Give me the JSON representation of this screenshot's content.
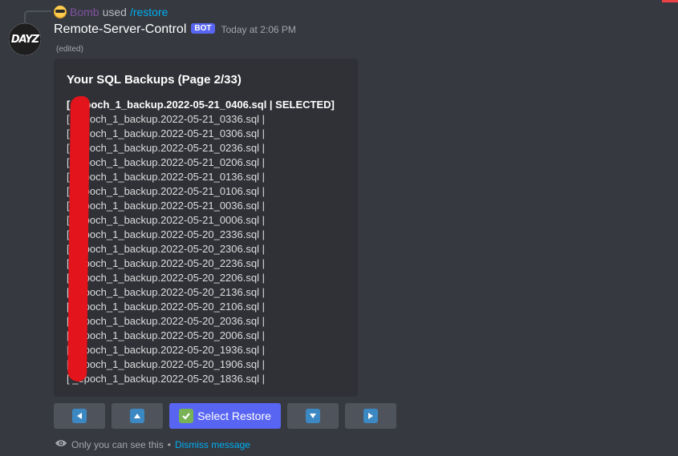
{
  "reply": {
    "username": "Bomb",
    "used_text": "used",
    "command": "/restore"
  },
  "message": {
    "author": "Remote-Server-Control",
    "bot_tag": "BOT",
    "timestamp": "Today at 2:06 PM",
    "edited": "(edited)",
    "avatar_text": "DAYZ"
  },
  "embed": {
    "title": "Your SQL Backups (Page 2/33)",
    "backups": [
      "[ _epoch_1_backup.2022-05-21_0406.sql | SELECTED]",
      "[ _epoch_1_backup.2022-05-21_0336.sql |",
      "[ _epoch_1_backup.2022-05-21_0306.sql |",
      "[ _epoch_1_backup.2022-05-21_0236.sql |",
      "[ _epoch_1_backup.2022-05-21_0206.sql |",
      "[ _epoch_1_backup.2022-05-21_0136.sql |",
      "[ _epoch_1_backup.2022-05-21_0106.sql |",
      "[ _epoch_1_backup.2022-05-21_0036.sql |",
      "[ _epoch_1_backup.2022-05-21_0006.sql |",
      "[ _epoch_1_backup.2022-05-20_2336.sql |",
      "[ _epoch_1_backup.2022-05-20_2306.sql |",
      "[ _epoch_1_backup.2022-05-20_2236.sql |",
      "[ _epoch_1_backup.2022-05-20_2206.sql |",
      "[ _epoch_1_backup.2022-05-20_2136.sql |",
      "[ _epoch_1_backup.2022-05-20_2106.sql |",
      "[ _epoch_1_backup.2022-05-20_2036.sql |",
      "[ _epoch_1_backup.2022-05-20_2006.sql |",
      "[ _epoch_1_backup.2022-05-20_1936.sql |",
      "[ _epoch_1_backup.2022-05-20_1906.sql |",
      "[ _epoch_1_backup.2022-05-20_1836.sql |"
    ],
    "selected_index": 0
  },
  "buttons": {
    "prev_icon": "left-arrow-icon",
    "up_icon": "up-arrow-icon",
    "select_label": "Select Restore",
    "select_icon": "check-mark-icon",
    "down_icon": "down-arrow-icon",
    "next_icon": "right-arrow-icon"
  },
  "footer": {
    "only_you": "Only you can see this",
    "separator": "•",
    "dismiss": "Dismiss message"
  },
  "colors": {
    "background": "#36393f",
    "embed_bg": "#2f3136",
    "blurple": "#5865f2",
    "grey_button": "#4f545c",
    "link": "#00aff4",
    "redaction": "#e3141b"
  }
}
